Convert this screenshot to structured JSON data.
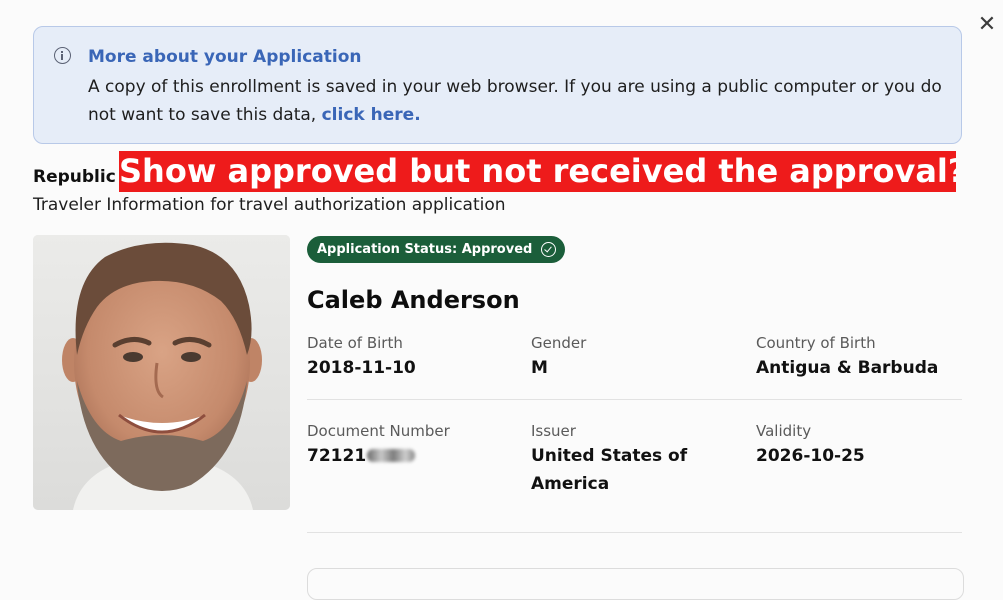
{
  "dialog": {
    "close_label": "✕"
  },
  "notice": {
    "title": "More about your Application",
    "body": "A copy of this enrollment is saved in your web browser. If you are using a public computer or you do not want to save this data, ",
    "link": "click here."
  },
  "header": {
    "republic_label": "Republic",
    "banner_text": "Show approved but not received the approval?",
    "subtitle": "Traveler Information for travel authorization application"
  },
  "traveler": {
    "status": "Application Status: Approved",
    "name": "Caleb Anderson",
    "fields": {
      "dob": {
        "label": "Date of Birth",
        "value": "2018-11-10"
      },
      "gender": {
        "label": "Gender",
        "value": "M"
      },
      "country_of_birth": {
        "label": "Country of Birth",
        "value": "Antigua & Barbuda"
      },
      "document_number": {
        "label": "Document Number",
        "value": "72121"
      },
      "issuer": {
        "label": "Issuer",
        "value": "United States of America"
      },
      "validity": {
        "label": "Validity",
        "value": "2026-10-25"
      }
    }
  },
  "icons": {
    "info": "info-circle-icon",
    "status": "check-circle-icon",
    "close": "close-icon"
  },
  "colors": {
    "notice_bg": "#e6edf8",
    "link": "#3a66b7",
    "banner": "#ee1b1b",
    "status_badge": "#1b5e3a"
  }
}
